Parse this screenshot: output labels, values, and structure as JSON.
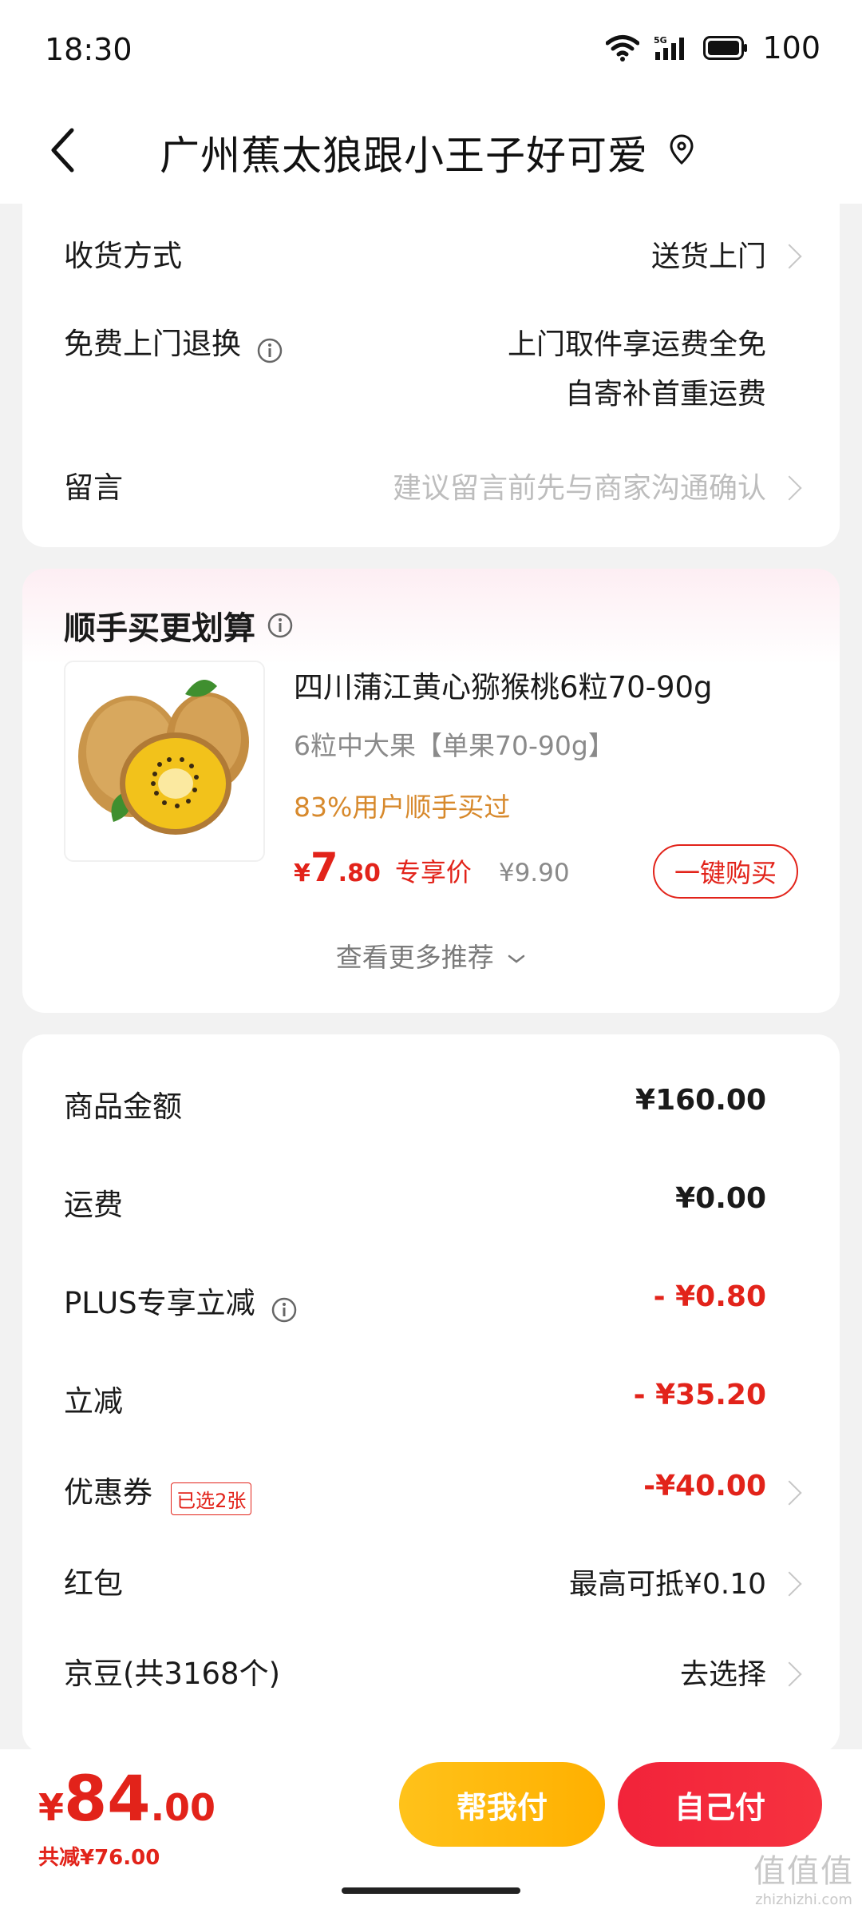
{
  "status_bar": {
    "time": "18:30",
    "battery": "100"
  },
  "nav": {
    "title": "广州蕉太狼跟小王子好可爱"
  },
  "delivery": {
    "method_label": "收货方式",
    "method_value": "送货上门",
    "return_label": "免费上门退换",
    "return_line1": "上门取件享运费全免",
    "return_line2": "自寄补首重运费",
    "note_label": "留言",
    "note_placeholder": "建议留言前先与商家沟通确认"
  },
  "addon": {
    "title": "顺手买更划算",
    "product_name": "四川蒲江黄心猕猴桃6粒70-90g",
    "spec": "6粒中大果【单果70-90g】",
    "bought": "83%用户顺手买过",
    "price_symbol": "¥",
    "price_int": "7",
    "price_dec": ".80",
    "price_tag": "专享价",
    "original_price": "¥9.90",
    "buy_button": "一键购买",
    "more": "查看更多推荐"
  },
  "summary": {
    "goods_label": "商品金额",
    "goods_value": "¥160.00",
    "shipping_label": "运费",
    "shipping_value": "¥0.00",
    "plus_label": "PLUS专享立减",
    "plus_value": "- ¥0.80",
    "discount_label": "立减",
    "discount_value": "- ¥35.20",
    "coupon_label": "优惠券",
    "coupon_badge": "已选2张",
    "coupon_value": "-¥40.00",
    "redpacket_label": "红包",
    "redpacket_value": "最高可抵¥0.10",
    "jingdou_label": "京豆(共3168个)",
    "jingdou_value": "去选择"
  },
  "footer": {
    "total_symbol": "¥",
    "total_int": "84",
    "total_dec": ".00",
    "saved": "共减¥76.00",
    "help_pay": "帮我付",
    "self_pay": "自己付"
  },
  "watermark": {
    "logo": "值值值",
    "url": "zhizhizhi.com"
  },
  "colors": {
    "accent_red": "#e2231a",
    "help_yellow": "#ffb000",
    "orange_text": "#d7892c"
  }
}
